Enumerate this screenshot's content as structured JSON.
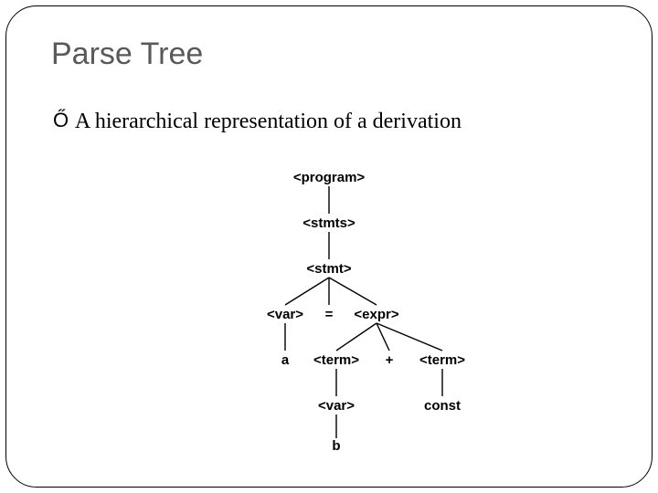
{
  "title": "Parse Tree",
  "bullet": {
    "icon": "Ő",
    "text": "A hierarchical representation of a derivation"
  },
  "tree": {
    "n_program": "<program>",
    "n_stmts": "<stmts>",
    "n_stmt": "<stmt>",
    "n_var": "<var>",
    "n_eq": "=",
    "n_expr": "<expr>",
    "n_a": "a",
    "n_term1": "<term>",
    "n_plus": "+",
    "n_term2": "<term>",
    "n_var2": "<var>",
    "n_const": "const",
    "n_b": "b"
  }
}
